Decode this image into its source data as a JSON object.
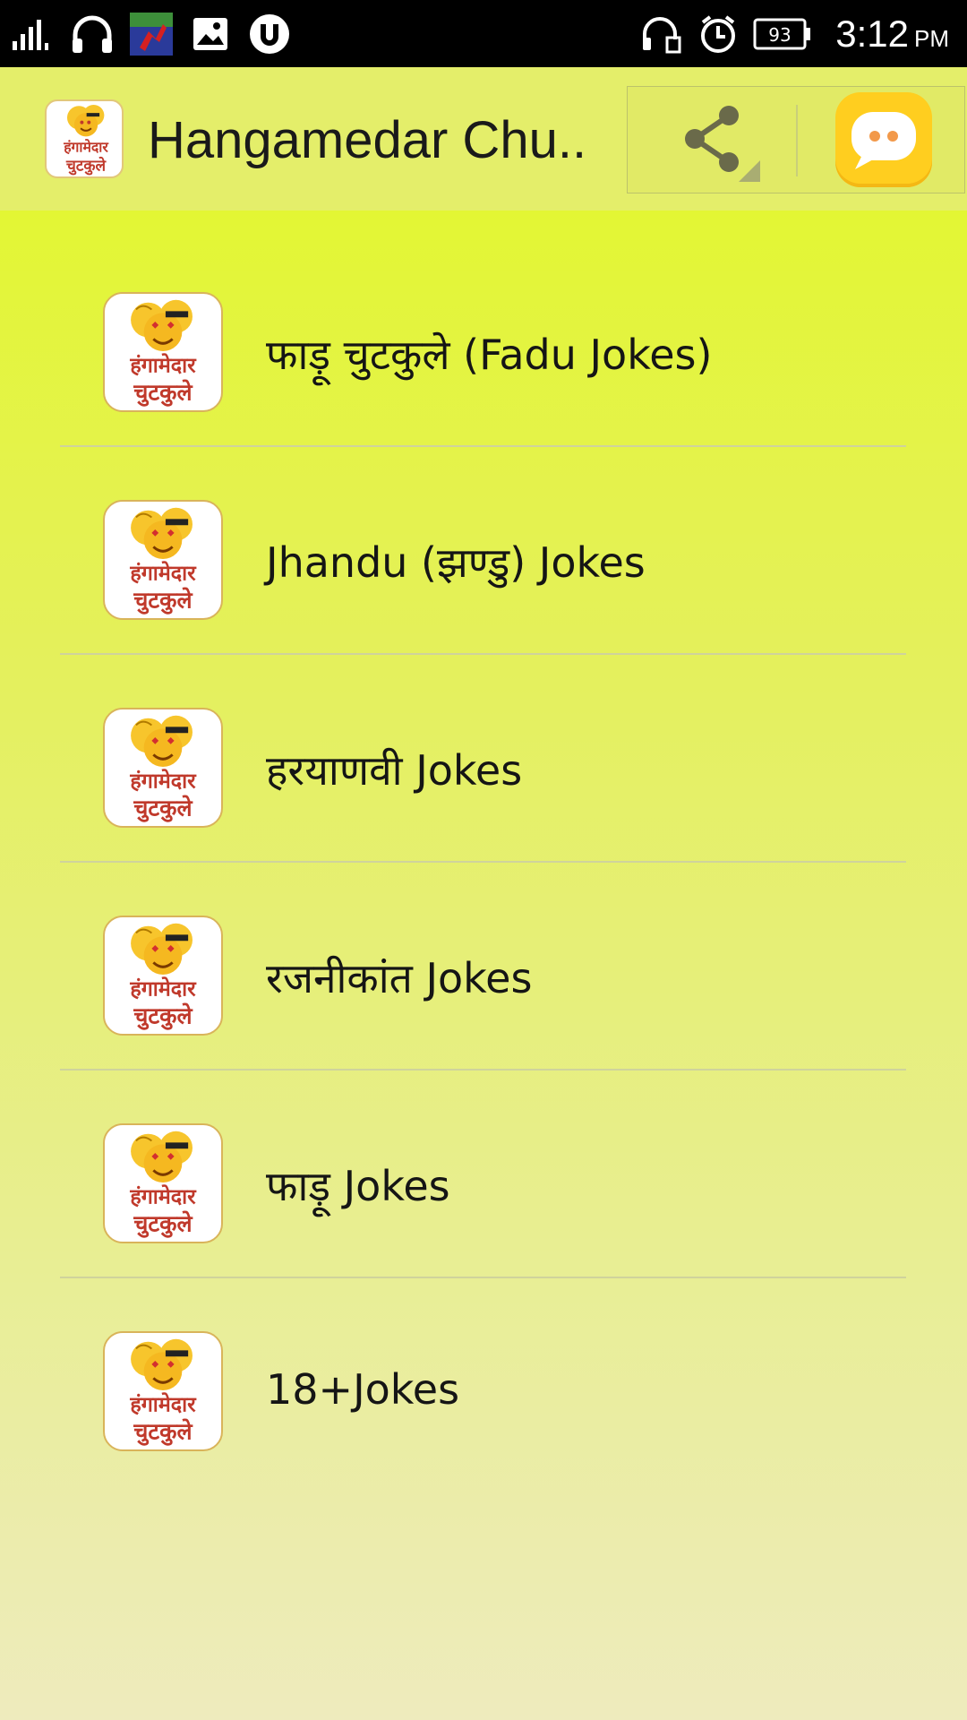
{
  "status_bar": {
    "icons": [
      "signal-icon",
      "headphones-icon",
      "app-thumbnail-icon",
      "image-icon",
      "utorrent-icon"
    ],
    "right_icons": [
      "headset-bluetooth-icon",
      "alarm-icon",
      "battery-icon"
    ],
    "battery_level": "93",
    "time": "3:12",
    "ampm": "PM"
  },
  "app_bar": {
    "title": "Hangamedar Chu..",
    "logo_text_line1": "हंगामेदार",
    "logo_text_line2": "चुटकुले"
  },
  "menu": {
    "items": [
      {
        "label": "फाड़ू चुटकुले (Fadu Jokes)"
      },
      {
        "label": "Jhandu (झण्डु) Jokes"
      },
      {
        "label": "हरयाणवी Jokes"
      },
      {
        "label": "रजनीकांत Jokes"
      },
      {
        "label": "फाड़ू Jokes"
      },
      {
        "label": "18+Jokes"
      }
    ]
  },
  "colors": {
    "app_bar": "#e4ee6a",
    "content_top": "#e3f634",
    "content_bottom": "#eeebbd",
    "chat_button": "#ffce1f"
  }
}
